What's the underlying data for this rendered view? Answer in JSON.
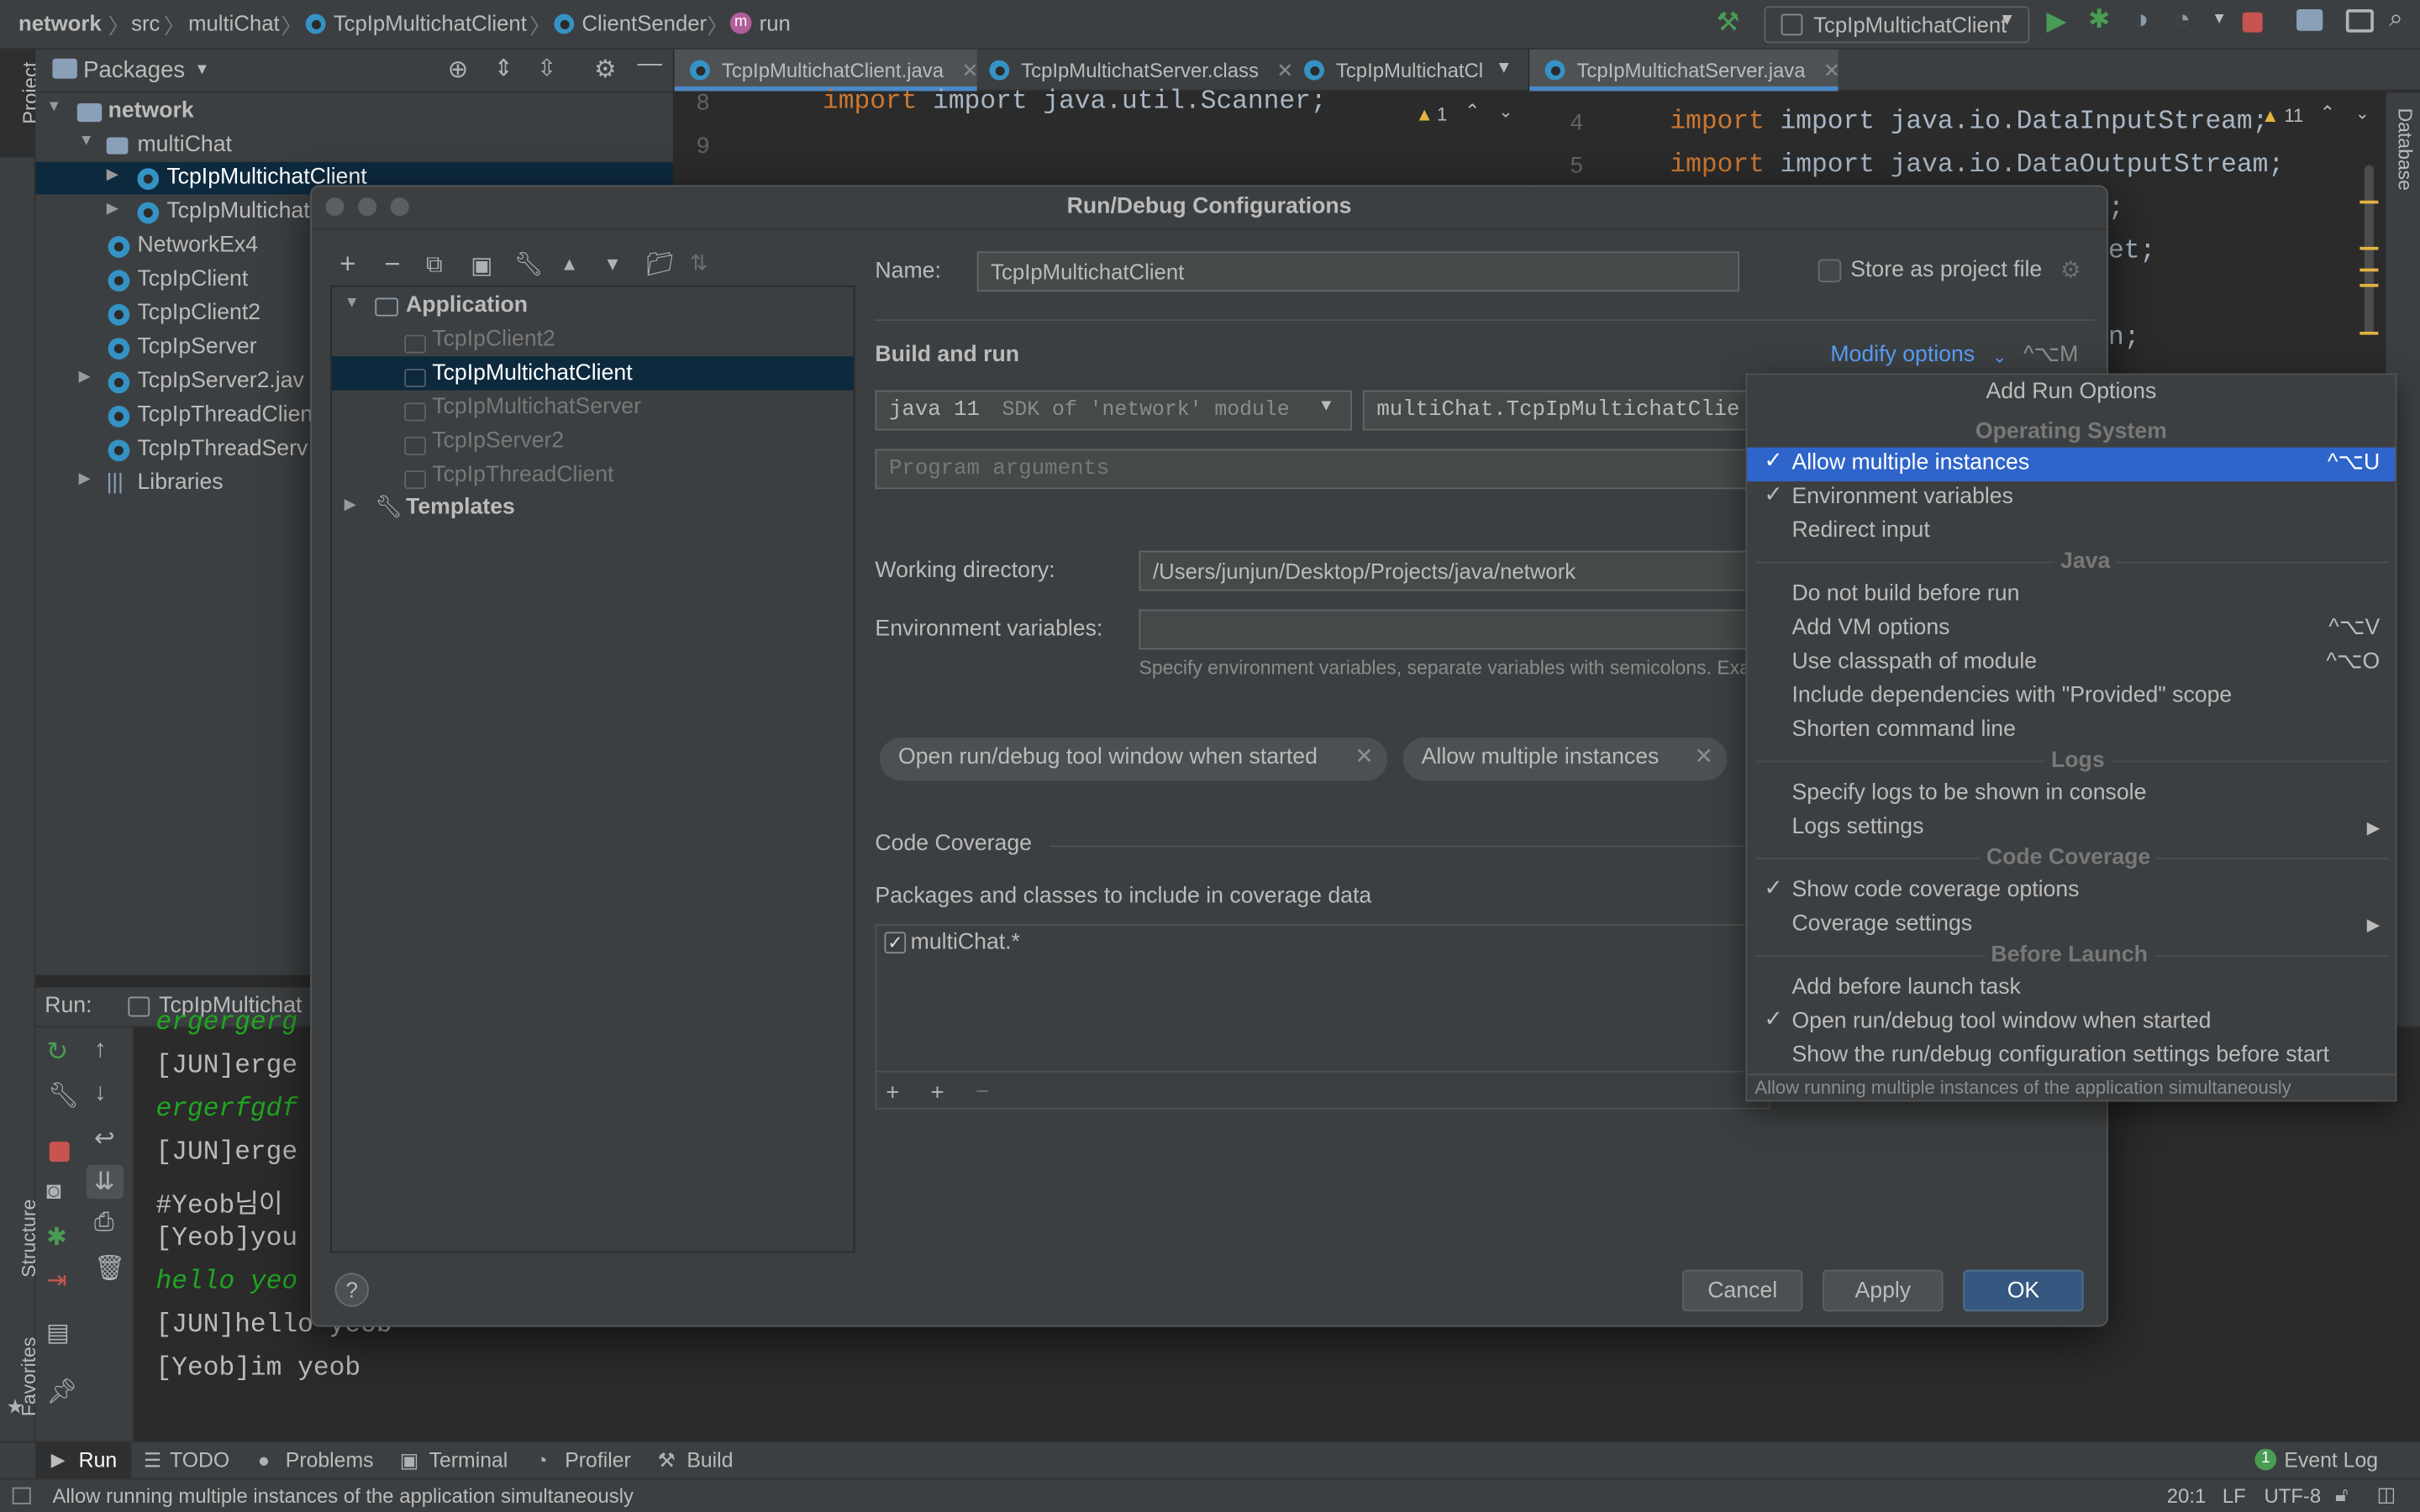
{
  "breadcrumb": {
    "items": [
      "network",
      "src",
      "multiChat",
      "TcpIpMultichatClient",
      "ClientSender",
      "run"
    ]
  },
  "toolbar": {
    "run_config": "TcpIpMultichatClient"
  },
  "project_panel": {
    "title": "Packages",
    "strip_label": "Project",
    "tree": [
      {
        "label": "network",
        "icon": "folder-icon"
      },
      {
        "label": "multiChat",
        "icon": "package-icon"
      },
      {
        "label": "TcpIpMultichatClient",
        "icon": "class-icon"
      },
      {
        "label": "TcpIpMultichatS",
        "icon": "class-icon"
      },
      {
        "label": "NetworkEx4",
        "icon": "class-icon"
      },
      {
        "label": "TcpIpClient",
        "icon": "class-icon"
      },
      {
        "label": "TcpIpClient2",
        "icon": "class-icon"
      },
      {
        "label": "TcpIpServer",
        "icon": "class-icon"
      },
      {
        "label": "TcpIpServer2.jav",
        "icon": "class-icon"
      },
      {
        "label": "TcpIpThreadClien",
        "icon": "class-icon"
      },
      {
        "label": "TcpIpThreadServ",
        "icon": "class-icon"
      },
      {
        "label": "Libraries",
        "icon": "libraries-icon"
      }
    ]
  },
  "editor_left": {
    "tabs": [
      "TcpIpMultichatClient.java",
      "TcpIpMultichatServer.class",
      "TcpIpMultichatCli"
    ],
    "line_numbers": [
      "8",
      "9"
    ],
    "code_line": "import java.util.Scanner;",
    "warning_count": "1"
  },
  "editor_right": {
    "tab": "TcpIpMultichatServer.java",
    "line_numbers": [
      "4",
      "5"
    ],
    "code_lines": [
      "import java.io.DataInputStream;",
      "import java.io.DataOutputStream;",
      ";",
      "et;",
      "n;"
    ],
    "warning_count": "11",
    "strip_label": "Database"
  },
  "run_panel": {
    "label": "Run:",
    "config": "TcpIpMultichat",
    "lines": [
      {
        "text": "ergergerg",
        "style": "green"
      },
      {
        "text": "[JUN]erge",
        "style": "plain"
      },
      {
        "text": "ergerfgdf",
        "style": "green"
      },
      {
        "text": "[JUN]erge",
        "style": "plain"
      },
      {
        "text": "#Yeob님이 ",
        "style": "plain"
      },
      {
        "text": "[Yeob]you",
        "style": "plain"
      },
      {
        "text": "hello yeo",
        "style": "green"
      },
      {
        "text": "[JUN]hello yeob",
        "style": "plain"
      },
      {
        "text": "[Yeob]im yeob",
        "style": "plain"
      }
    ]
  },
  "side_labels": {
    "structure": "Structure",
    "favorites": "Favorites"
  },
  "tool_windows": [
    "Run",
    "TODO",
    "Problems",
    "Terminal",
    "Profiler",
    "Build"
  ],
  "event_log": {
    "label": "Event Log",
    "count": "1"
  },
  "status_bar": {
    "message": "Allow running multiple instances of the application simultaneously",
    "position": "20:1",
    "line_sep": "LF",
    "encoding": "UTF-8"
  },
  "dialog": {
    "title": "Run/Debug Configurations",
    "tree": {
      "application": "Application",
      "configs": [
        "TcpIpClient2",
        "TcpIpMultichatClient",
        "TcpIpMultichatServer",
        "TcpIpServer2",
        "TcpIpThreadClient"
      ],
      "templates": "Templates"
    },
    "name_label": "Name:",
    "name_value": "TcpIpMultichatClient",
    "store_label": "Store as project file",
    "build_and_run": "Build and run",
    "modify_options": "Modify options",
    "modify_shortcut": "^⌥M",
    "sdk_value": "java 11",
    "sdk_hint": "SDK of 'network' module",
    "main_class": "multiChat.TcpIpMultichatClie",
    "program_args_placeholder": "Program arguments",
    "working_dir_label": "Working directory:",
    "working_dir_value": "/Users/junjun/Desktop/Projects/java/network",
    "env_label": "Environment variables:",
    "env_hint": "Specify environment variables, separate variables with semicolons. Exar",
    "chips": [
      "Open run/debug tool window when started",
      "Allow multiple instances"
    ],
    "coverage_title": "Code Coverage",
    "coverage_packages_label": "Packages and classes to include in coverage data",
    "coverage_entry": "multiChat.*",
    "buttons": {
      "cancel": "Cancel",
      "apply": "Apply",
      "ok": "OK"
    },
    "help": "?"
  },
  "popup": {
    "title": "Add Run Options",
    "tooltip": "Allow running multiple instances of the application simultaneously",
    "groups": [
      {
        "header": "Operating System",
        "items": [
          {
            "label": "Allow multiple instances",
            "checked": true,
            "shortcut": "^⌥U",
            "selected": true
          },
          {
            "label": "Environment variables",
            "checked": true,
            "shortcut": ""
          },
          {
            "label": "Redirect input",
            "checked": false,
            "shortcut": ""
          }
        ]
      },
      {
        "header": "Java",
        "items": [
          {
            "label": "Do not build before run",
            "checked": false,
            "shortcut": ""
          },
          {
            "label": "Add VM options",
            "checked": false,
            "shortcut": "^⌥V"
          },
          {
            "label": "Use classpath of module",
            "checked": false,
            "shortcut": "^⌥O"
          },
          {
            "label": "Include dependencies with \"Provided\" scope",
            "checked": false,
            "shortcut": ""
          },
          {
            "label": "Shorten command line",
            "checked": false,
            "shortcut": ""
          }
        ]
      },
      {
        "header": "Logs",
        "items": [
          {
            "label": "Specify logs to be shown in console",
            "checked": false,
            "shortcut": ""
          },
          {
            "label": "Logs settings",
            "checked": false,
            "shortcut": "",
            "submenu": true
          }
        ]
      },
      {
        "header": "Code Coverage",
        "items": [
          {
            "label": "Show code coverage options",
            "checked": true,
            "shortcut": ""
          },
          {
            "label": "Coverage settings",
            "checked": false,
            "shortcut": "",
            "submenu": true
          }
        ]
      },
      {
        "header": "Before Launch",
        "items": [
          {
            "label": "Add before launch task",
            "checked": false,
            "shortcut": ""
          },
          {
            "label": "Open run/debug tool window when started",
            "checked": true,
            "shortcut": ""
          },
          {
            "label": "Show the run/debug configuration settings before start",
            "checked": false,
            "shortcut": ""
          }
        ]
      }
    ]
  },
  "colors": {
    "selection": "#2f65ca",
    "keyword": "#cc7832",
    "class_icon": "#3592c4",
    "run_green": "#499c54",
    "output_green": "#21a621"
  }
}
